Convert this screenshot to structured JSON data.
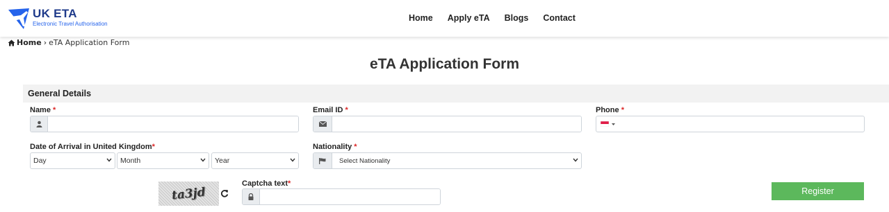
{
  "brand": {
    "title": "UK ETA",
    "subtitle": "Electronic Travel Authorisation",
    "color": "#1e3a8a"
  },
  "nav": {
    "items": [
      "Home",
      "Apply eTA",
      "Blogs",
      "Contact"
    ]
  },
  "breadcrumb": {
    "home": "Home",
    "separator": "›",
    "current": "eTA Application Form"
  },
  "page_title": "eTA Application Form",
  "section": {
    "title": "General Details"
  },
  "form": {
    "name_label": "Name",
    "email_label": "Email ID",
    "phone_label": "Phone",
    "arrival_label": "Date of Arrival in United Kingdom",
    "nationality_label": "Nationality",
    "required_marker": "*",
    "day_selected": "Day",
    "month_selected": "Month",
    "year_selected": "Year",
    "nationality_selected": "Select Nationality",
    "captcha_label": "Captcha text",
    "captcha_image_text": "ta3jd",
    "register_label": "Register"
  },
  "colors": {
    "accent": "#5cb85c",
    "required": "#dc2626",
    "section_bg": "#f2f2f2"
  },
  "icons": [
    "plane-logo",
    "home-icon",
    "user-icon",
    "envelope-icon",
    "flag-icon",
    "lock-icon",
    "refresh-icon",
    "chevron-down-icon"
  ]
}
